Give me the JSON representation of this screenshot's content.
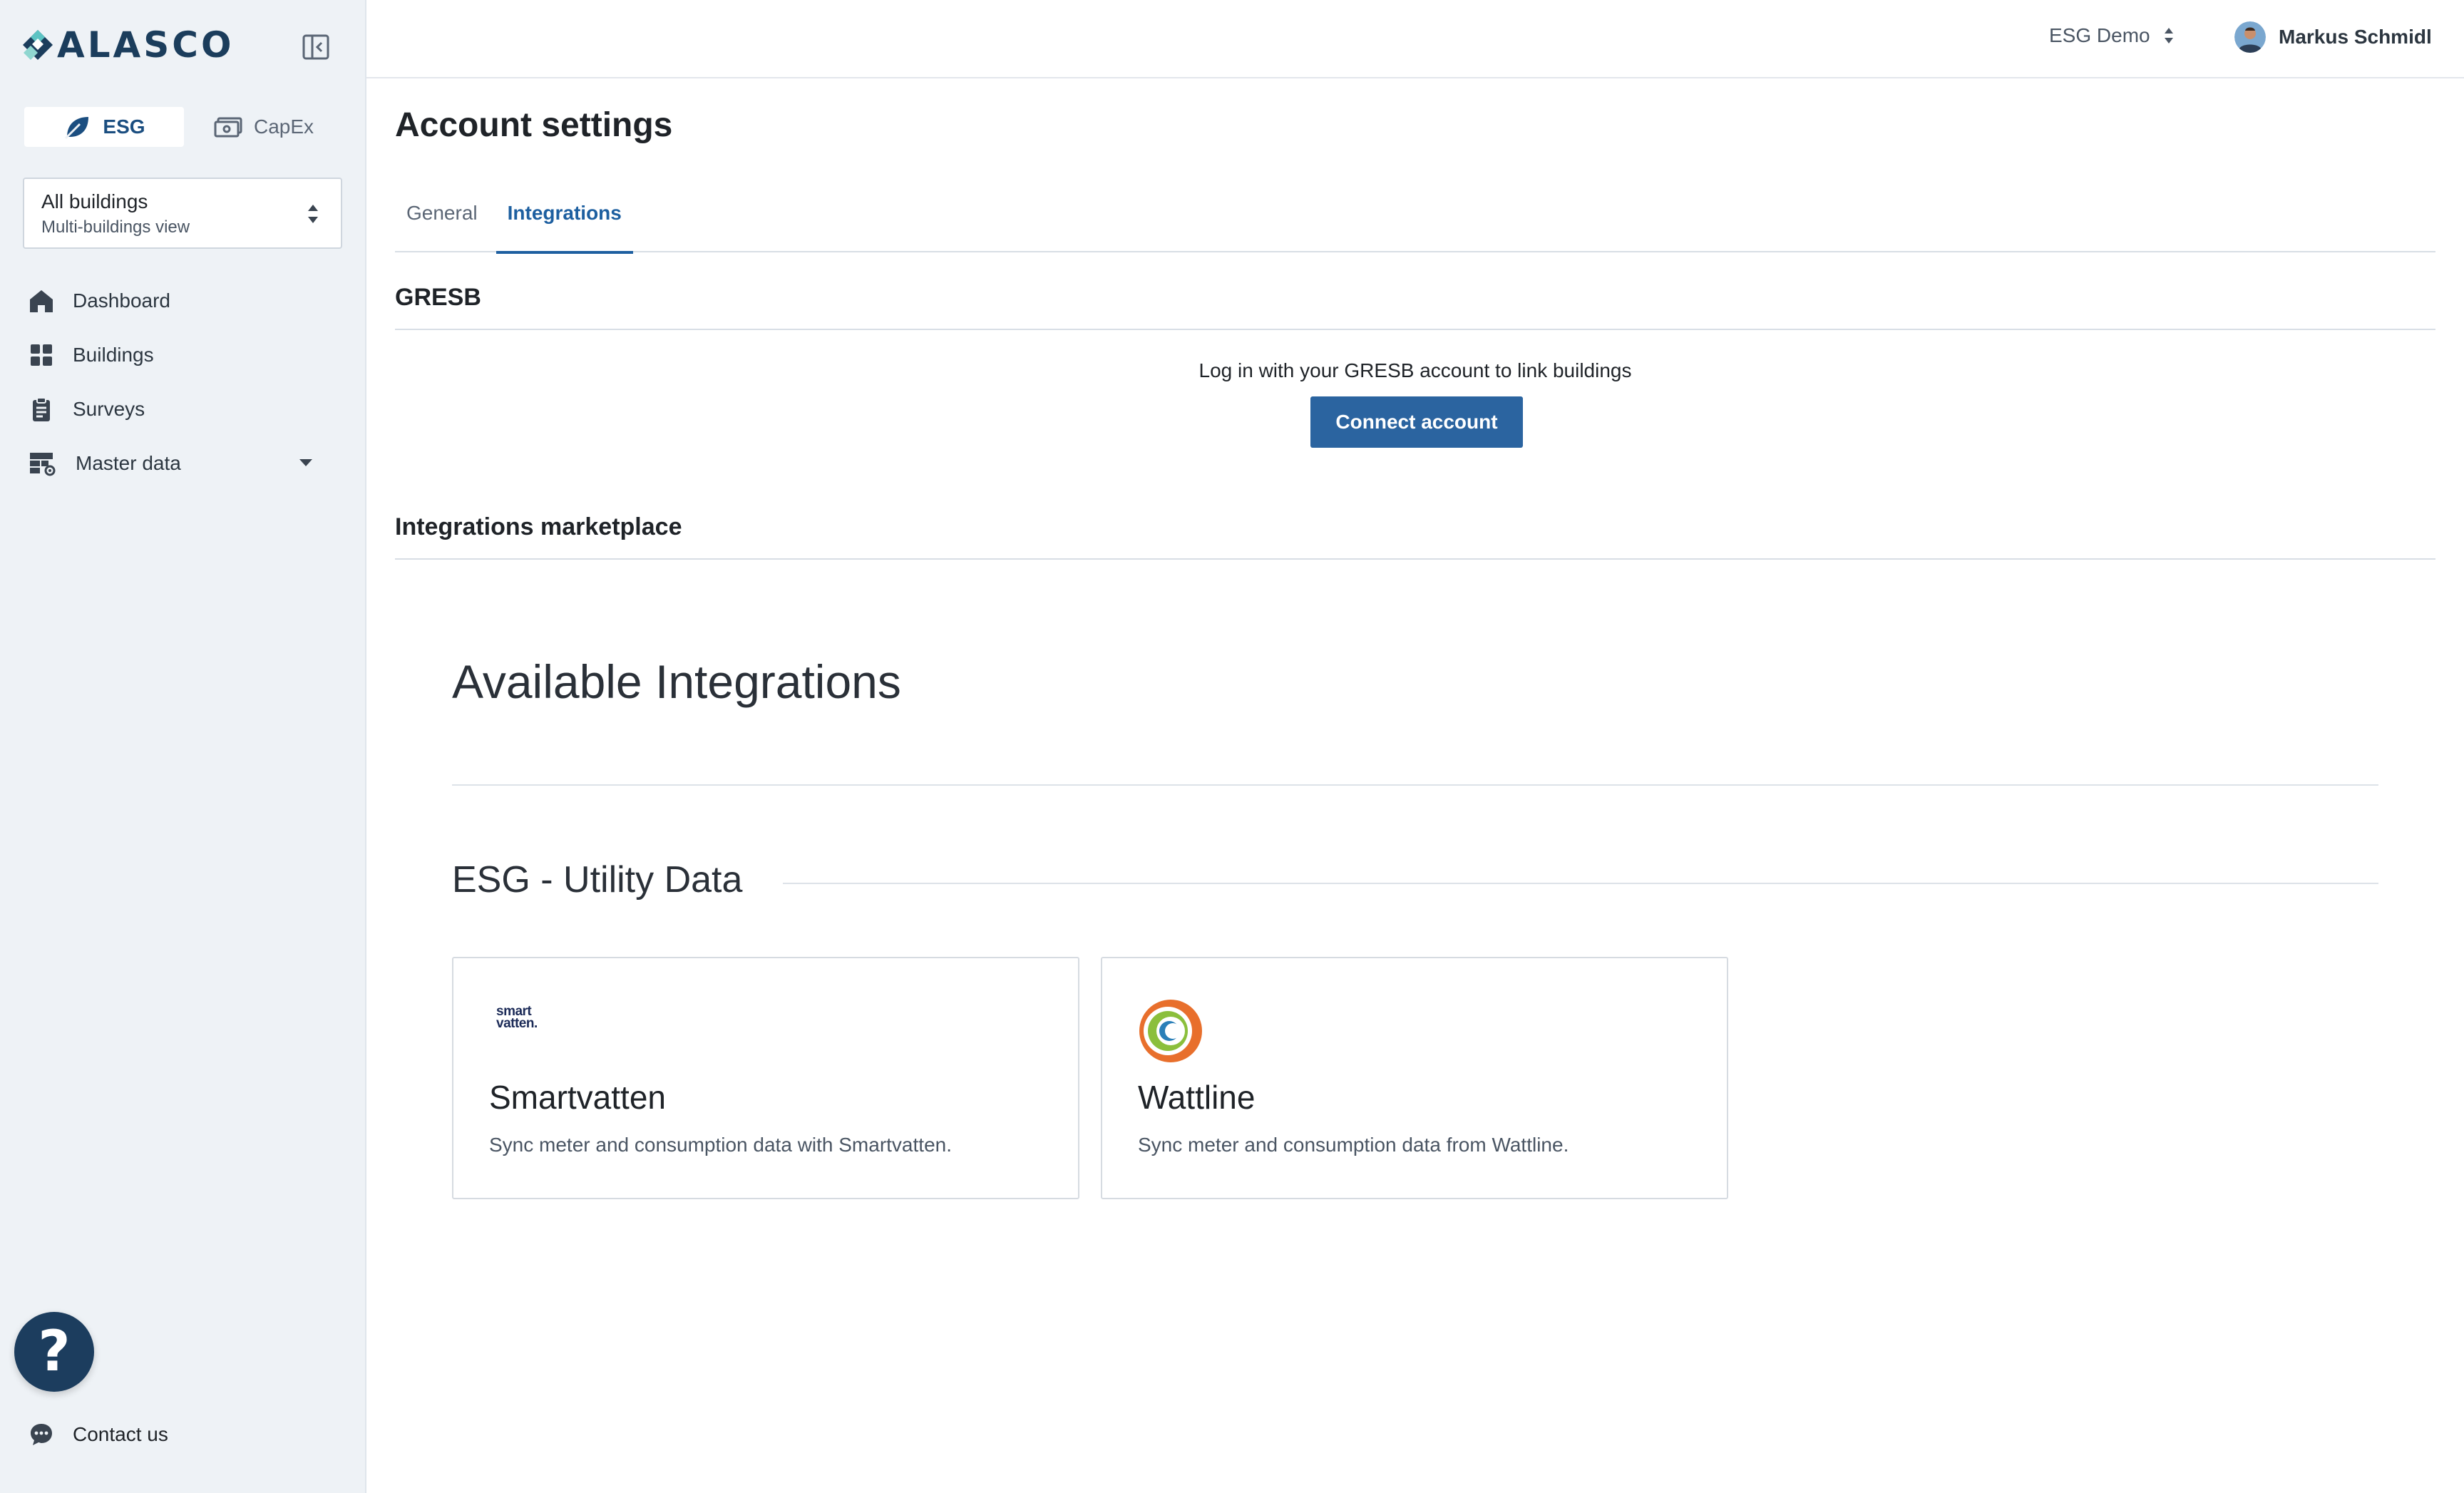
{
  "brand": {
    "logo_text": "ALASCO",
    "primary_color": "#1b4e80",
    "button_color": "#2b64a0",
    "sidebar_bg": "#eef2f6"
  },
  "sidebar": {
    "modules": [
      {
        "label": "ESG",
        "icon": "leaf-icon",
        "active": true
      },
      {
        "label": "CapEx",
        "icon": "money-icon",
        "active": false
      }
    ],
    "building_select": {
      "title": "All buildings",
      "subtitle": "Multi-buildings view"
    },
    "nav": [
      {
        "label": "Dashboard",
        "icon": "home-icon"
      },
      {
        "label": "Buildings",
        "icon": "grid-icon"
      },
      {
        "label": "Surveys",
        "icon": "clipboard-icon"
      },
      {
        "label": "Master data",
        "icon": "table-settings-icon"
      }
    ],
    "help_label": "?",
    "contact_label": "Contact us"
  },
  "topbar": {
    "org": "ESG Demo",
    "user_name": "Markus Schmidl"
  },
  "main": {
    "title": "Account settings",
    "tabs": [
      {
        "label": "General",
        "active": false
      },
      {
        "label": "Integrations",
        "active": true
      }
    ],
    "gresb": {
      "heading": "GRESB",
      "text": "Log in with your GRESB account to link buildings",
      "button": "Connect account"
    },
    "marketplace": {
      "heading": "Integrations marketplace",
      "available_title": "Available Integrations",
      "category": "ESG - Utility Data",
      "cards": [
        {
          "name": "Smartvatten",
          "description": "Sync meter and consumption data with Smartvatten.",
          "logo_text_1": "smart",
          "logo_text_2": "vatten."
        },
        {
          "name": "Wattline",
          "description": "Sync meter and consumption data from Wattline."
        }
      ]
    }
  }
}
